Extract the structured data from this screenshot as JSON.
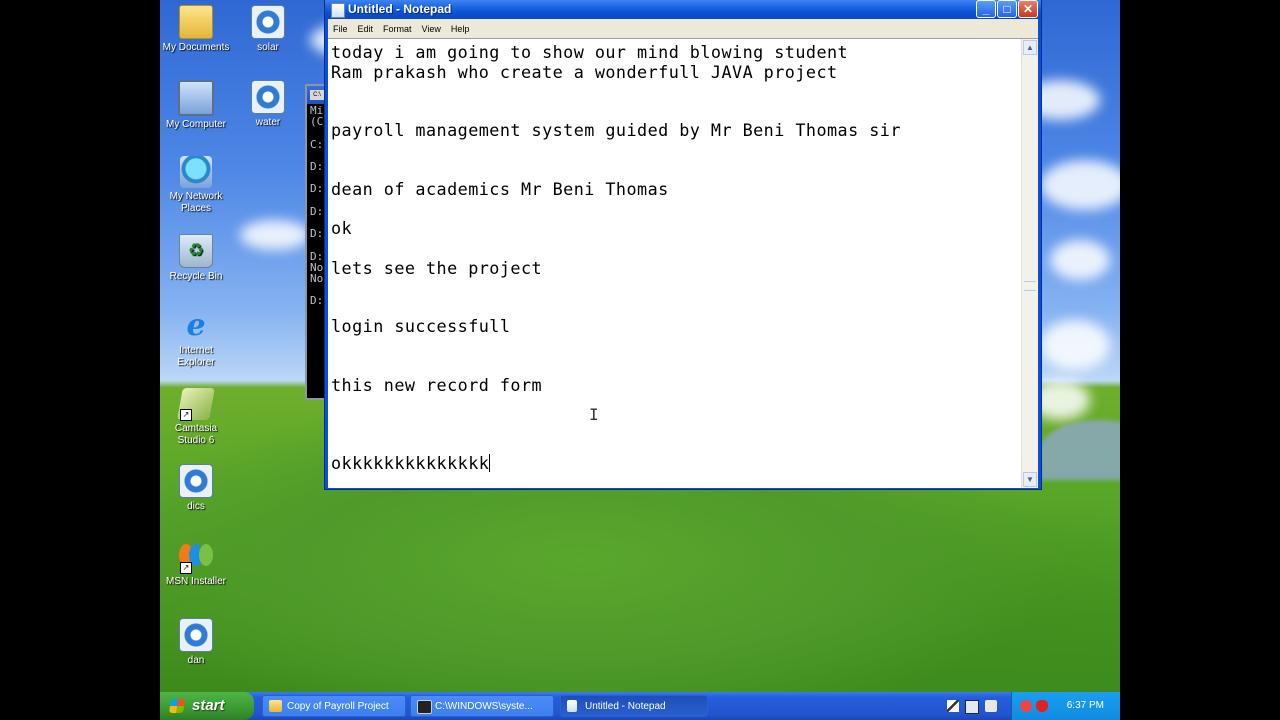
{
  "desktop": {
    "icons": [
      {
        "name": "my-documents-icon",
        "label": "My Documents"
      },
      {
        "name": "solar-icon",
        "label": "solar"
      },
      {
        "name": "my-computer-icon",
        "label": "My Computer"
      },
      {
        "name": "water-icon",
        "label": "water"
      },
      {
        "name": "my-network-places-icon",
        "label": "My Network Places"
      },
      {
        "name": "recycle-bin-icon",
        "label": "Recycle Bin"
      },
      {
        "name": "internet-explorer-icon",
        "label": "Internet Explorer"
      },
      {
        "name": "camtasia-studio-icon",
        "label": "Camtasia Studio 6"
      },
      {
        "name": "dics-icon",
        "label": "dics"
      },
      {
        "name": "msn-installer-icon",
        "label": "MSN Installer"
      },
      {
        "name": "dan-icon",
        "label": "dan"
      }
    ]
  },
  "console": {
    "lines": "Mi\n(C\n\nC:\n\nD:\n\nD:\n\nD:\n\nD:\n\nD:\nNo\nNo\n\nD:"
  },
  "notepad": {
    "title": "Untitled - Notepad",
    "menu": [
      "File",
      "Edit",
      "Format",
      "View",
      "Help"
    ],
    "buttons": {
      "minimize": "_",
      "maximize": "□",
      "close": "✕"
    },
    "text_lines": [
      "today i am going to show our mind blowing student",
      "Ram prakash who create a wonderfull JAVA project",
      "",
      "",
      "payroll management system guided by Mr Beni Thomas sir",
      "",
      "",
      "dean of academics Mr Beni Thomas",
      "",
      "ok",
      "",
      "lets see the project",
      "",
      "",
      "login successfull",
      "",
      "",
      "this new record form",
      "",
      "",
      "",
      "okkkkkkkkkkkkkk"
    ]
  },
  "taskbar": {
    "start_label": "start",
    "tasks": [
      {
        "label": "Copy of Payroll Project",
        "icon": "folder-icon"
      },
      {
        "label": "C:\\WINDOWS\\syste...",
        "icon": "console-icon"
      },
      {
        "label": "Untitled - Notepad",
        "icon": "notepad-icon"
      }
    ],
    "clock": "6:37 PM"
  }
}
